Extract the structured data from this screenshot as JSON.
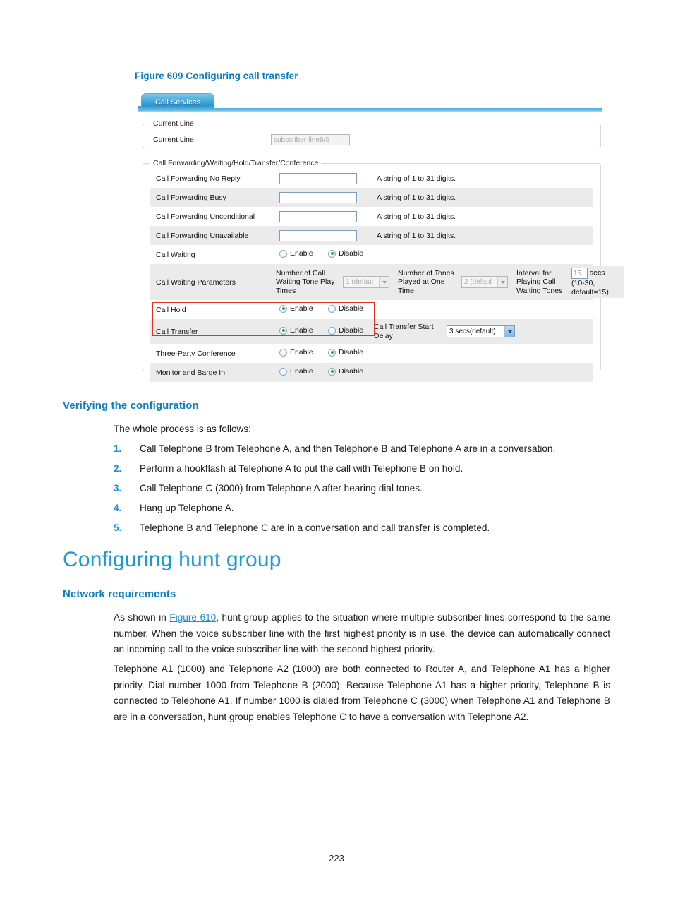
{
  "figure": {
    "caption": "Figure 609 Configuring call transfer",
    "tab_label": "Call Services",
    "current_line_panel": {
      "legend": "Current Line",
      "row_label": "Current Line",
      "value": "subscriber-line8/0"
    },
    "call_panel": {
      "legend": "Call Forwarding/Waiting/Hold/Transfer/Conference",
      "hint_digits": "A string of 1 to 31 digits.",
      "enable_label": "Enable",
      "disable_label": "Disable",
      "rows": {
        "cf_no_reply": "Call Forwarding No Reply",
        "cf_busy": "Call Forwarding Busy",
        "cf_unconditional": "Call Forwarding Unconditional",
        "cf_unavailable": "Call Forwarding Unavailable",
        "call_waiting": "Call Waiting",
        "call_waiting_params": "Call Waiting Parameters",
        "call_hold": "Call Hold",
        "call_transfer": "Call Transfer",
        "three_party": "Three-Party Conference",
        "monitor_barge": "Monitor and Barge In"
      },
      "waiting_params": {
        "tone_play_times_label": "Number of Call Waiting Tone Play Times",
        "tone_play_times_value": "1 (defaul",
        "tones_at_once_label": "Number of Tones Played at One Time",
        "tones_at_once_value": "2 (defaul",
        "interval_label": "Interval for Playing Call Waiting Tones",
        "interval_value": "15",
        "interval_unit": "secs",
        "interval_hint": "(10-30, default=15)"
      },
      "transfer_delay": {
        "label": "Call Transfer Start Delay",
        "value": "3 secs(default)"
      }
    }
  },
  "sections": {
    "verifying_heading": "Verifying the configuration",
    "verifying_intro": "The whole process is as follows:",
    "steps": [
      {
        "num": "1.",
        "text": "Call Telephone B from Telephone A, and then Telephone B and Telephone A are in a conversation."
      },
      {
        "num": "2.",
        "text": "Perform a hookflash at Telephone A to put the call with Telephone B on hold."
      },
      {
        "num": "3.",
        "text": "Call Telephone C (3000) from Telephone A after hearing dial tones."
      },
      {
        "num": "4.",
        "text": "Hang up Telephone A."
      },
      {
        "num": "5.",
        "text": "Telephone B and Telephone C are in a conversation and call transfer is completed."
      }
    ],
    "chapter_heading": "Configuring hunt group",
    "network_heading": "Network requirements",
    "para1_before": "As shown in ",
    "para1_link": "Figure 610",
    "para1_after": ", hunt group applies to the situation where multiple subscriber lines correspond to the same number. When the voice subscriber line with the first highest priority is in use, the device can automatically connect an incoming call to the voice subscriber line with the second highest priority.",
    "para2": "Telephone A1 (1000) and Telephone A2 (1000) are both connected to Router A, and Telephone A1 has a higher priority. Dial number 1000 from Telephone B (2000). Because Telephone A1 has a higher priority, Telephone B is connected to Telephone A1. If number 1000 is dialed from Telephone C (3000) when Telephone A1 and Telephone B are in a conversation, hunt group enables Telephone C to have a conversation with Telephone A2."
  },
  "page_number": "223",
  "colors": {
    "heading_blue": "#0d7dc0",
    "chapter_blue": "#1b9ad6",
    "link_blue": "#1e8fd0",
    "highlight_red": "#e03323",
    "radio_on_green": "#2f9e33"
  }
}
